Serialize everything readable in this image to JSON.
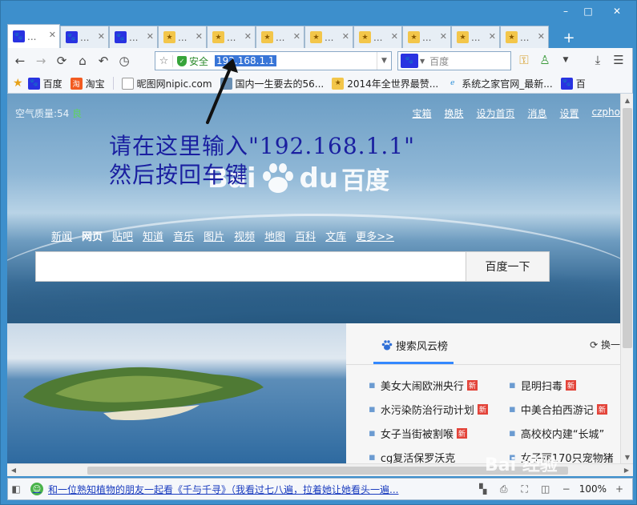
{
  "window": {
    "controls": [
      "–",
      "□",
      "✕"
    ]
  },
  "tabs": [
    {
      "label": "...",
      "icon": "baidu-paw-icon",
      "active": true
    },
    {
      "label": "...",
      "icon": "baidu-paw-icon"
    },
    {
      "label": "...",
      "icon": "baidu-paw-icon"
    },
    {
      "label": "...",
      "icon": "trophy-icon"
    },
    {
      "label": "...",
      "icon": "trophy-icon"
    },
    {
      "label": "...",
      "icon": "trophy-icon"
    },
    {
      "label": "...",
      "icon": "trophy-icon"
    },
    {
      "label": "...",
      "icon": "trophy-icon"
    },
    {
      "label": "...",
      "icon": "trophy-icon"
    },
    {
      "label": "...",
      "icon": "trophy-icon"
    },
    {
      "label": "...",
      "icon": "trophy-icon"
    },
    {
      "label": "...",
      "icon": "trophy-icon"
    }
  ],
  "new_tab": "+",
  "toolbar": {
    "secure_label": "安全",
    "url": "192.168.1.1",
    "search_placeholder": "百度"
  },
  "bookmarks": [
    {
      "label": "百度",
      "icon": "baidu-paw-icon"
    },
    {
      "label": "淘宝",
      "icon": "taobao-icon"
    },
    {
      "label": "昵图网nipic.com",
      "icon": "page-icon"
    },
    {
      "label": "国内一生要去的56...",
      "icon": "photo-icon"
    },
    {
      "label": "2014年全世界最赞...",
      "icon": "trophy-icon"
    },
    {
      "label": "系统之家官网_最新...",
      "icon": "ie-icon"
    },
    {
      "label": "百",
      "icon": "baidu-paw-icon"
    }
  ],
  "page": {
    "air_quality": "空气质量:54",
    "air_quality_level": "良",
    "top_links": [
      "宝箱",
      "换肤",
      "设为首页",
      "消息",
      "设置",
      "czpho"
    ],
    "note_line1": "请在这里输入\"192.168.1.1\"",
    "note_line2": "然后按回车键",
    "logo_text": "Bai",
    "logo_text2": "du",
    "logo_cn": "百度",
    "nav": [
      "新闻",
      "网页",
      "贴吧",
      "知道",
      "音乐",
      "图片",
      "视频",
      "地图",
      "百科",
      "文库",
      "更多>>"
    ],
    "search_button": "百度一下",
    "hot_title": "搜索风云榜",
    "refresh": "换一",
    "hot_items": [
      [
        "美女大闹欧洲央行",
        "昆明扫毒"
      ],
      [
        "水污染防治行动计划",
        "中美合拍西游记"
      ],
      [
        "女子当街被割喉",
        "高校校内建“长城”"
      ],
      [
        "cg复活保罗沃克",
        "女子丽170只宠物猪"
      ]
    ],
    "new_badge": "新"
  },
  "status": {
    "news": "和一位熟知植物的朋友一起看《千与千寻》（我看过七八遍，拉着她让她看头一遍...",
    "zoom": "100%"
  },
  "watermark": "Bai 经验"
}
